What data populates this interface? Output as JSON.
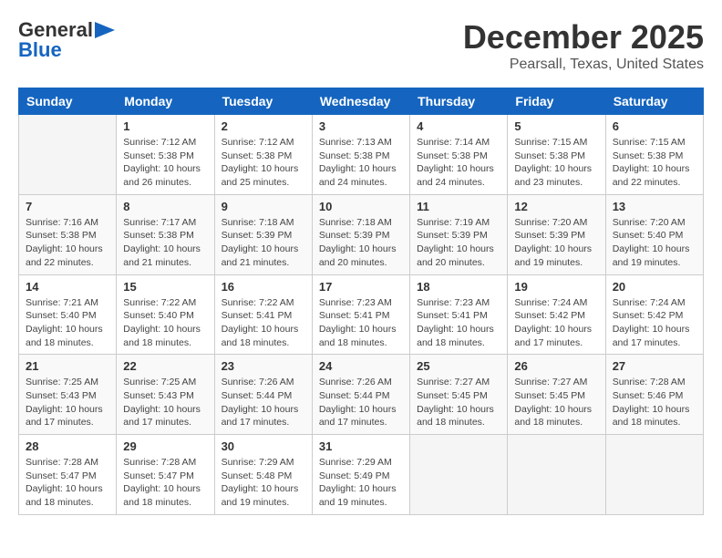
{
  "logo": {
    "line1": "General",
    "line2": "Blue"
  },
  "header": {
    "title": "December 2025",
    "subtitle": "Pearsall, Texas, United States"
  },
  "calendar": {
    "days_of_week": [
      "Sunday",
      "Monday",
      "Tuesday",
      "Wednesday",
      "Thursday",
      "Friday",
      "Saturday"
    ],
    "weeks": [
      [
        {
          "day": "",
          "info": ""
        },
        {
          "day": "1",
          "info": "Sunrise: 7:12 AM\nSunset: 5:38 PM\nDaylight: 10 hours\nand 26 minutes."
        },
        {
          "day": "2",
          "info": "Sunrise: 7:12 AM\nSunset: 5:38 PM\nDaylight: 10 hours\nand 25 minutes."
        },
        {
          "day": "3",
          "info": "Sunrise: 7:13 AM\nSunset: 5:38 PM\nDaylight: 10 hours\nand 24 minutes."
        },
        {
          "day": "4",
          "info": "Sunrise: 7:14 AM\nSunset: 5:38 PM\nDaylight: 10 hours\nand 24 minutes."
        },
        {
          "day": "5",
          "info": "Sunrise: 7:15 AM\nSunset: 5:38 PM\nDaylight: 10 hours\nand 23 minutes."
        },
        {
          "day": "6",
          "info": "Sunrise: 7:15 AM\nSunset: 5:38 PM\nDaylight: 10 hours\nand 22 minutes."
        }
      ],
      [
        {
          "day": "7",
          "info": "Sunrise: 7:16 AM\nSunset: 5:38 PM\nDaylight: 10 hours\nand 22 minutes."
        },
        {
          "day": "8",
          "info": "Sunrise: 7:17 AM\nSunset: 5:38 PM\nDaylight: 10 hours\nand 21 minutes."
        },
        {
          "day": "9",
          "info": "Sunrise: 7:18 AM\nSunset: 5:39 PM\nDaylight: 10 hours\nand 21 minutes."
        },
        {
          "day": "10",
          "info": "Sunrise: 7:18 AM\nSunset: 5:39 PM\nDaylight: 10 hours\nand 20 minutes."
        },
        {
          "day": "11",
          "info": "Sunrise: 7:19 AM\nSunset: 5:39 PM\nDaylight: 10 hours\nand 20 minutes."
        },
        {
          "day": "12",
          "info": "Sunrise: 7:20 AM\nSunset: 5:39 PM\nDaylight: 10 hours\nand 19 minutes."
        },
        {
          "day": "13",
          "info": "Sunrise: 7:20 AM\nSunset: 5:40 PM\nDaylight: 10 hours\nand 19 minutes."
        }
      ],
      [
        {
          "day": "14",
          "info": "Sunrise: 7:21 AM\nSunset: 5:40 PM\nDaylight: 10 hours\nand 18 minutes."
        },
        {
          "day": "15",
          "info": "Sunrise: 7:22 AM\nSunset: 5:40 PM\nDaylight: 10 hours\nand 18 minutes."
        },
        {
          "day": "16",
          "info": "Sunrise: 7:22 AM\nSunset: 5:41 PM\nDaylight: 10 hours\nand 18 minutes."
        },
        {
          "day": "17",
          "info": "Sunrise: 7:23 AM\nSunset: 5:41 PM\nDaylight: 10 hours\nand 18 minutes."
        },
        {
          "day": "18",
          "info": "Sunrise: 7:23 AM\nSunset: 5:41 PM\nDaylight: 10 hours\nand 18 minutes."
        },
        {
          "day": "19",
          "info": "Sunrise: 7:24 AM\nSunset: 5:42 PM\nDaylight: 10 hours\nand 17 minutes."
        },
        {
          "day": "20",
          "info": "Sunrise: 7:24 AM\nSunset: 5:42 PM\nDaylight: 10 hours\nand 17 minutes."
        }
      ],
      [
        {
          "day": "21",
          "info": "Sunrise: 7:25 AM\nSunset: 5:43 PM\nDaylight: 10 hours\nand 17 minutes."
        },
        {
          "day": "22",
          "info": "Sunrise: 7:25 AM\nSunset: 5:43 PM\nDaylight: 10 hours\nand 17 minutes."
        },
        {
          "day": "23",
          "info": "Sunrise: 7:26 AM\nSunset: 5:44 PM\nDaylight: 10 hours\nand 17 minutes."
        },
        {
          "day": "24",
          "info": "Sunrise: 7:26 AM\nSunset: 5:44 PM\nDaylight: 10 hours\nand 17 minutes."
        },
        {
          "day": "25",
          "info": "Sunrise: 7:27 AM\nSunset: 5:45 PM\nDaylight: 10 hours\nand 18 minutes."
        },
        {
          "day": "26",
          "info": "Sunrise: 7:27 AM\nSunset: 5:45 PM\nDaylight: 10 hours\nand 18 minutes."
        },
        {
          "day": "27",
          "info": "Sunrise: 7:28 AM\nSunset: 5:46 PM\nDaylight: 10 hours\nand 18 minutes."
        }
      ],
      [
        {
          "day": "28",
          "info": "Sunrise: 7:28 AM\nSunset: 5:47 PM\nDaylight: 10 hours\nand 18 minutes."
        },
        {
          "day": "29",
          "info": "Sunrise: 7:28 AM\nSunset: 5:47 PM\nDaylight: 10 hours\nand 18 minutes."
        },
        {
          "day": "30",
          "info": "Sunrise: 7:29 AM\nSunset: 5:48 PM\nDaylight: 10 hours\nand 19 minutes."
        },
        {
          "day": "31",
          "info": "Sunrise: 7:29 AM\nSunset: 5:49 PM\nDaylight: 10 hours\nand 19 minutes."
        },
        {
          "day": "",
          "info": ""
        },
        {
          "day": "",
          "info": ""
        },
        {
          "day": "",
          "info": ""
        }
      ]
    ]
  }
}
